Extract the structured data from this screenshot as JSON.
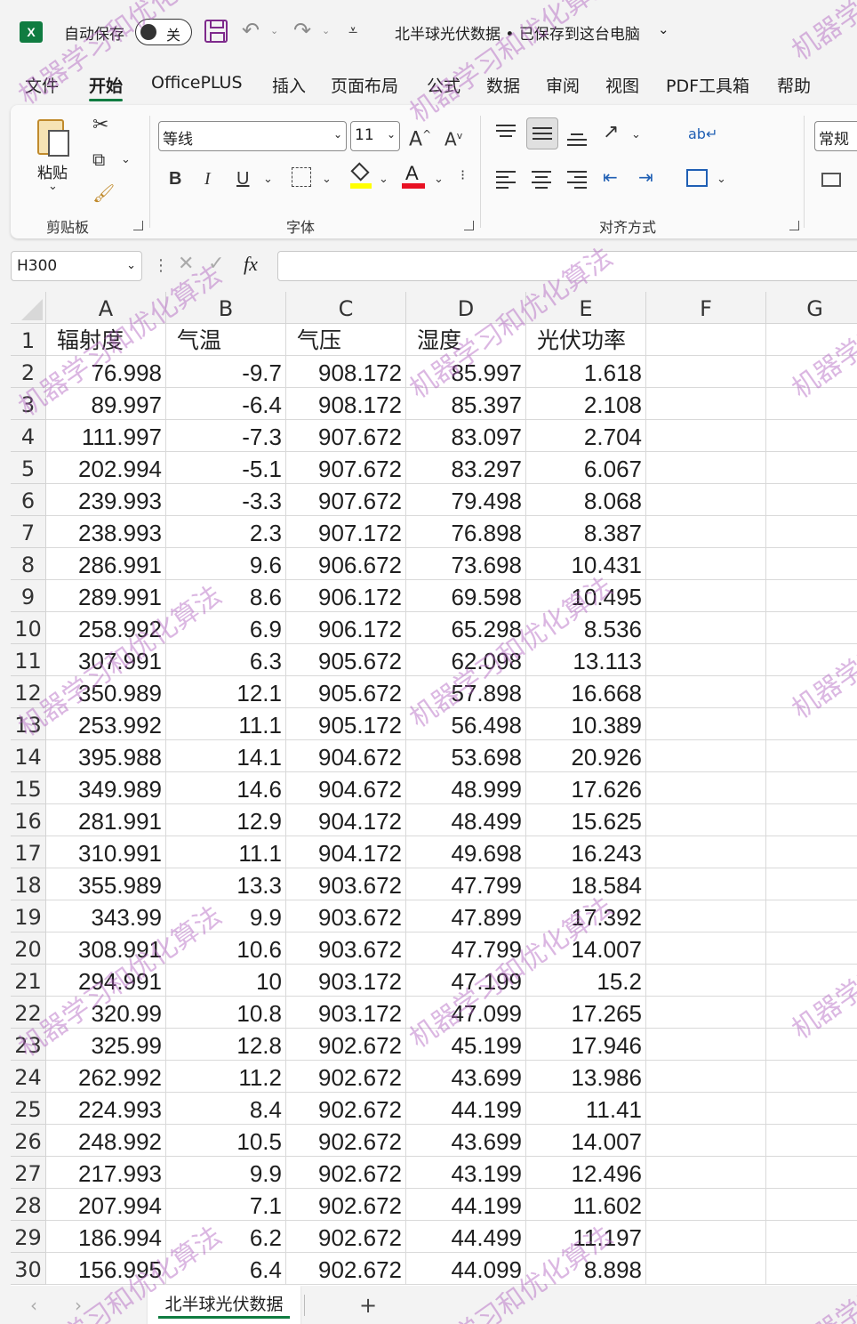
{
  "titlebar": {
    "app_icon": "X",
    "autosave_label": "自动保存",
    "autosave_state": "关",
    "doc_title": "北半球光伏数据 • 已保存到这台电脑",
    "icons": [
      "save-icon",
      "undo-icon",
      "redo-icon",
      "customize-qat-icon",
      "chevron-down-icon"
    ]
  },
  "menu": {
    "tabs": [
      "文件",
      "开始",
      "OfficePLUS",
      "插入",
      "页面布局",
      "公式",
      "数据",
      "审阅",
      "视图",
      "PDF工具箱",
      "帮助"
    ],
    "active": "开始"
  },
  "ribbon": {
    "clipboard": {
      "paste_label": "粘贴",
      "group_label": "剪贴板"
    },
    "font": {
      "font_name": "等线",
      "font_size": "11",
      "grow_label": "A",
      "shrink_label": "A",
      "bold": "B",
      "italic": "I",
      "underline": "U",
      "color_glyph": "A",
      "group_label": "字体",
      "highlight_color": "#ffff00",
      "font_color": "#e81123"
    },
    "alignment": {
      "group_label": "对齐方式"
    },
    "number": {
      "format": "常规"
    }
  },
  "formula_bar": {
    "name_box": "H300",
    "fx_label": "fx",
    "value": ""
  },
  "sheet": {
    "columns": [
      "A",
      "B",
      "C",
      "D",
      "E",
      "F",
      "G"
    ],
    "headers": [
      "辐射度",
      "气温",
      "气压",
      "湿度",
      "光伏功率"
    ],
    "rows": [
      [
        "76.998",
        "-9.7",
        "908.172",
        "85.997",
        "1.618"
      ],
      [
        "89.997",
        "-6.4",
        "908.172",
        "85.397",
        "2.108"
      ],
      [
        "111.997",
        "-7.3",
        "907.672",
        "83.097",
        "2.704"
      ],
      [
        "202.994",
        "-5.1",
        "907.672",
        "83.297",
        "6.067"
      ],
      [
        "239.993",
        "-3.3",
        "907.672",
        "79.498",
        "8.068"
      ],
      [
        "238.993",
        "2.3",
        "907.172",
        "76.898",
        "8.387"
      ],
      [
        "286.991",
        "9.6",
        "906.672",
        "73.698",
        "10.431"
      ],
      [
        "289.991",
        "8.6",
        "906.172",
        "69.598",
        "10.495"
      ],
      [
        "258.992",
        "6.9",
        "906.172",
        "65.298",
        "8.536"
      ],
      [
        "307.991",
        "6.3",
        "905.672",
        "62.098",
        "13.113"
      ],
      [
        "350.989",
        "12.1",
        "905.672",
        "57.898",
        "16.668"
      ],
      [
        "253.992",
        "11.1",
        "905.172",
        "56.498",
        "10.389"
      ],
      [
        "395.988",
        "14.1",
        "904.672",
        "53.698",
        "20.926"
      ],
      [
        "349.989",
        "14.6",
        "904.672",
        "48.999",
        "17.626"
      ],
      [
        "281.991",
        "12.9",
        "904.172",
        "48.499",
        "15.625"
      ],
      [
        "310.991",
        "11.1",
        "904.172",
        "49.698",
        "16.243"
      ],
      [
        "355.989",
        "13.3",
        "903.672",
        "47.799",
        "18.584"
      ],
      [
        "343.99",
        "9.9",
        "903.672",
        "47.899",
        "17.392"
      ],
      [
        "308.991",
        "10.6",
        "903.672",
        "47.799",
        "14.007"
      ],
      [
        "294.991",
        "10",
        "903.172",
        "47.199",
        "15.2"
      ],
      [
        "320.99",
        "10.8",
        "903.172",
        "47.099",
        "17.265"
      ],
      [
        "325.99",
        "12.8",
        "902.672",
        "45.199",
        "17.946"
      ],
      [
        "262.992",
        "11.2",
        "902.672",
        "43.699",
        "13.986"
      ],
      [
        "224.993",
        "8.4",
        "902.672",
        "44.199",
        "11.41"
      ],
      [
        "248.992",
        "10.5",
        "902.672",
        "43.699",
        "14.007"
      ],
      [
        "217.993",
        "9.9",
        "902.672",
        "43.199",
        "12.496"
      ],
      [
        "207.994",
        "7.1",
        "902.672",
        "44.199",
        "11.602"
      ],
      [
        "186.994",
        "6.2",
        "902.672",
        "44.499",
        "11.197"
      ],
      [
        "156.995",
        "6.4",
        "902.672",
        "44.099",
        "8.898"
      ]
    ]
  },
  "sheet_tabs": {
    "active": "北半球光伏数据",
    "add_label": "+"
  },
  "watermark": {
    "text": "机器学习和优化算法"
  },
  "colors": {
    "excel_green": "#107c41",
    "save_purple": "#7e2a8c",
    "watermark": "#b060be"
  }
}
